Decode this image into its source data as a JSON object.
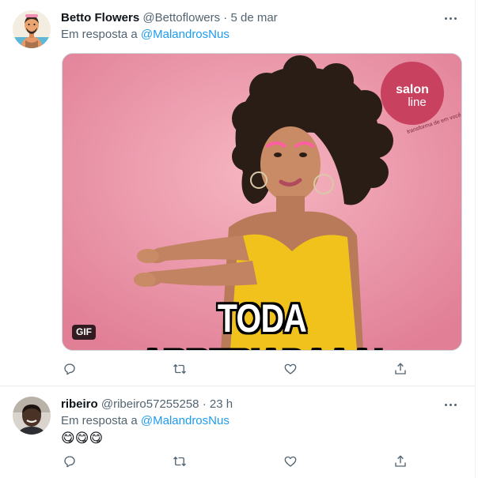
{
  "tweets": [
    {
      "display_name": "Betto Flowers",
      "handle": "@Bettoflowers",
      "separator": "·",
      "time": "5 de mar",
      "reply_prefix": "Em resposta a",
      "reply_to": "@MalandrosNus",
      "media": {
        "type": "gif",
        "badge": "GIF",
        "caption": "TODA ARREPIADAAA!",
        "logo_line1": "salon",
        "logo_line2": "line",
        "logo_tagline": "transforma de em você"
      },
      "avatar_icon": "illustrated-man-avatar"
    },
    {
      "display_name": "ribeiro",
      "handle": "@ribeiro57255258",
      "separator": "·",
      "time": "23 h",
      "reply_prefix": "Em resposta a",
      "reply_to": "@MalandrosNus",
      "body": "😋😋😋",
      "avatar_icon": "photo-avatar"
    }
  ],
  "actions": [
    "reply-icon",
    "retweet-icon",
    "like-icon",
    "share-icon"
  ],
  "colors": {
    "link": "#1d9bf0",
    "muted": "#536471",
    "media_bg": "#e98ea4",
    "logo_bg": "#c8415f"
  }
}
